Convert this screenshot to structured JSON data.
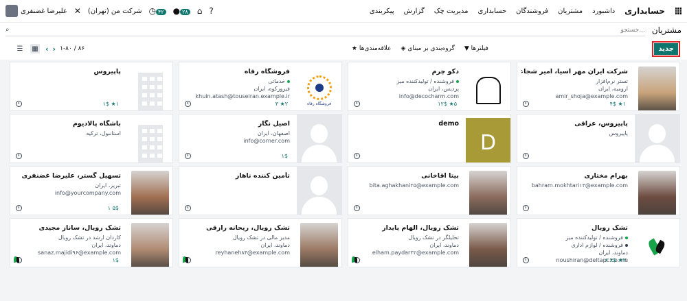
{
  "navbar": {
    "app_name": "حسابداری",
    "menu": [
      "داشبورد",
      "مشتریان",
      "فروشندگان",
      "حسابداری",
      "مدیریت چک",
      "گزارش",
      "پیکربندی"
    ],
    "user_name": "علیرضا غضنفری",
    "company": "شرکت من (تهران)",
    "messages_badge": "۲۸",
    "activities_badge": "۴۲"
  },
  "search": {
    "placeholder": "جستجو..."
  },
  "page_title": "مشتریان",
  "toolbar": {
    "new_label": "جدید",
    "filters_label": "فیلترها",
    "groupby_label": "گروه‌بندی بر مبنای",
    "favorites_label": "علاقه‌مندی‌ها",
    "pager_text": "۱-۸۰ / ۸۶"
  },
  "cards": [
    {
      "name": "شرکت ایران مهر آسیا، امیر شجاعی",
      "lines": [
        "تستر نرم‌افزار",
        "ارومیه، ایران",
        "amir_shoja@example.com"
      ],
      "stats": "۱★ ۴$",
      "image": "photo"
    },
    {
      "name": "دکو چرم",
      "tags": [
        "فروشنده / تولیدکننده میز"
      ],
      "lines": [
        "پردیس، ایران",
        "info@decocharm.com"
      ],
      "stats": "۵★ ۱۲$",
      "image": "chair"
    },
    {
      "name": "فروشگاه رفاه",
      "tags": [
        "خدماتی"
      ],
      "lines": [
        "فیروزکوه، ایران",
        "khuin.atash@touseiran.example.ir"
      ],
      "stats": "۲★ ۳",
      "image": "logo",
      "logo_text": "فروشگاه رفاه"
    },
    {
      "name": "پاپیروس",
      "lines": [],
      "stats": "۱★ ۱$",
      "image": "building"
    },
    {
      "name": "پاپیروس، عراقی",
      "lines": [
        "پاپیروس"
      ],
      "stats": "",
      "image": "person"
    },
    {
      "name": "demo",
      "lines": [],
      "stats": "",
      "image": "letter",
      "letter": "D"
    },
    {
      "name": "اصیل نگار",
      "lines": [
        "اصفهان، ایران",
        "info@corner.com"
      ],
      "stats": "۱$",
      "image": "person"
    },
    {
      "name": "باشگاه پالادیوم",
      "lines": [
        "استانبول، ترکیه"
      ],
      "stats": "",
      "image": "building"
    },
    {
      "name": "بهرام مختاری",
      "lines": [
        "bahram.mokhtari۱۳@example.com"
      ],
      "stats": "",
      "image": "photo"
    },
    {
      "name": "بیتا آقاخانی",
      "lines": [
        "bita.aghakhani۲۵@example.com"
      ],
      "stats": "",
      "image": "photo"
    },
    {
      "name": "تأمین کننده ناهار",
      "lines": [],
      "stats": "",
      "image": "person"
    },
    {
      "name": "تسهیل گستر، علیرضا غضنفری",
      "lines": [
        "تبریز، ایران",
        "info@yourcompany.com"
      ],
      "stats": "۵$ ۱",
      "image": "photo"
    },
    {
      "name": "تشک رویال",
      "tags": [
        "فروشنده / تولیدکننده میز",
        "فروشنده / لوازم اداری"
      ],
      "lines": [
        "دماوند، ایران",
        "noushiran@deltapc.co.me"
      ],
      "stats": "۳★ ۴$ ۶",
      "image": "leaf"
    },
    {
      "name": "تشک رویال، الهام پایدار",
      "lines": [
        "تحلیلگر در تشک رویال",
        "دماوند، ایران",
        "elham.paydar۲۲@example.com"
      ],
      "stats": "",
      "image": "photo"
    },
    {
      "name": "تشک رویال، ریحانه رازقی",
      "lines": [
        "مدیر مالی در تشک رویال",
        "دماوند، ایران",
        "reyhaneh۸۴@example.com"
      ],
      "stats": "",
      "image": "photo"
    },
    {
      "name": "تشک رویال، ساناز مجیدی",
      "lines": [
        "کاردان ارشد در تشک رویال",
        "دماوند، ایران",
        "sanaz.majidi۹۶@example.com"
      ],
      "stats": "۱$",
      "image": "photo"
    }
  ],
  "colors": {
    "primary": "#0f766e",
    "highlight": "#dc2626",
    "background": "#f3f4f6"
  }
}
